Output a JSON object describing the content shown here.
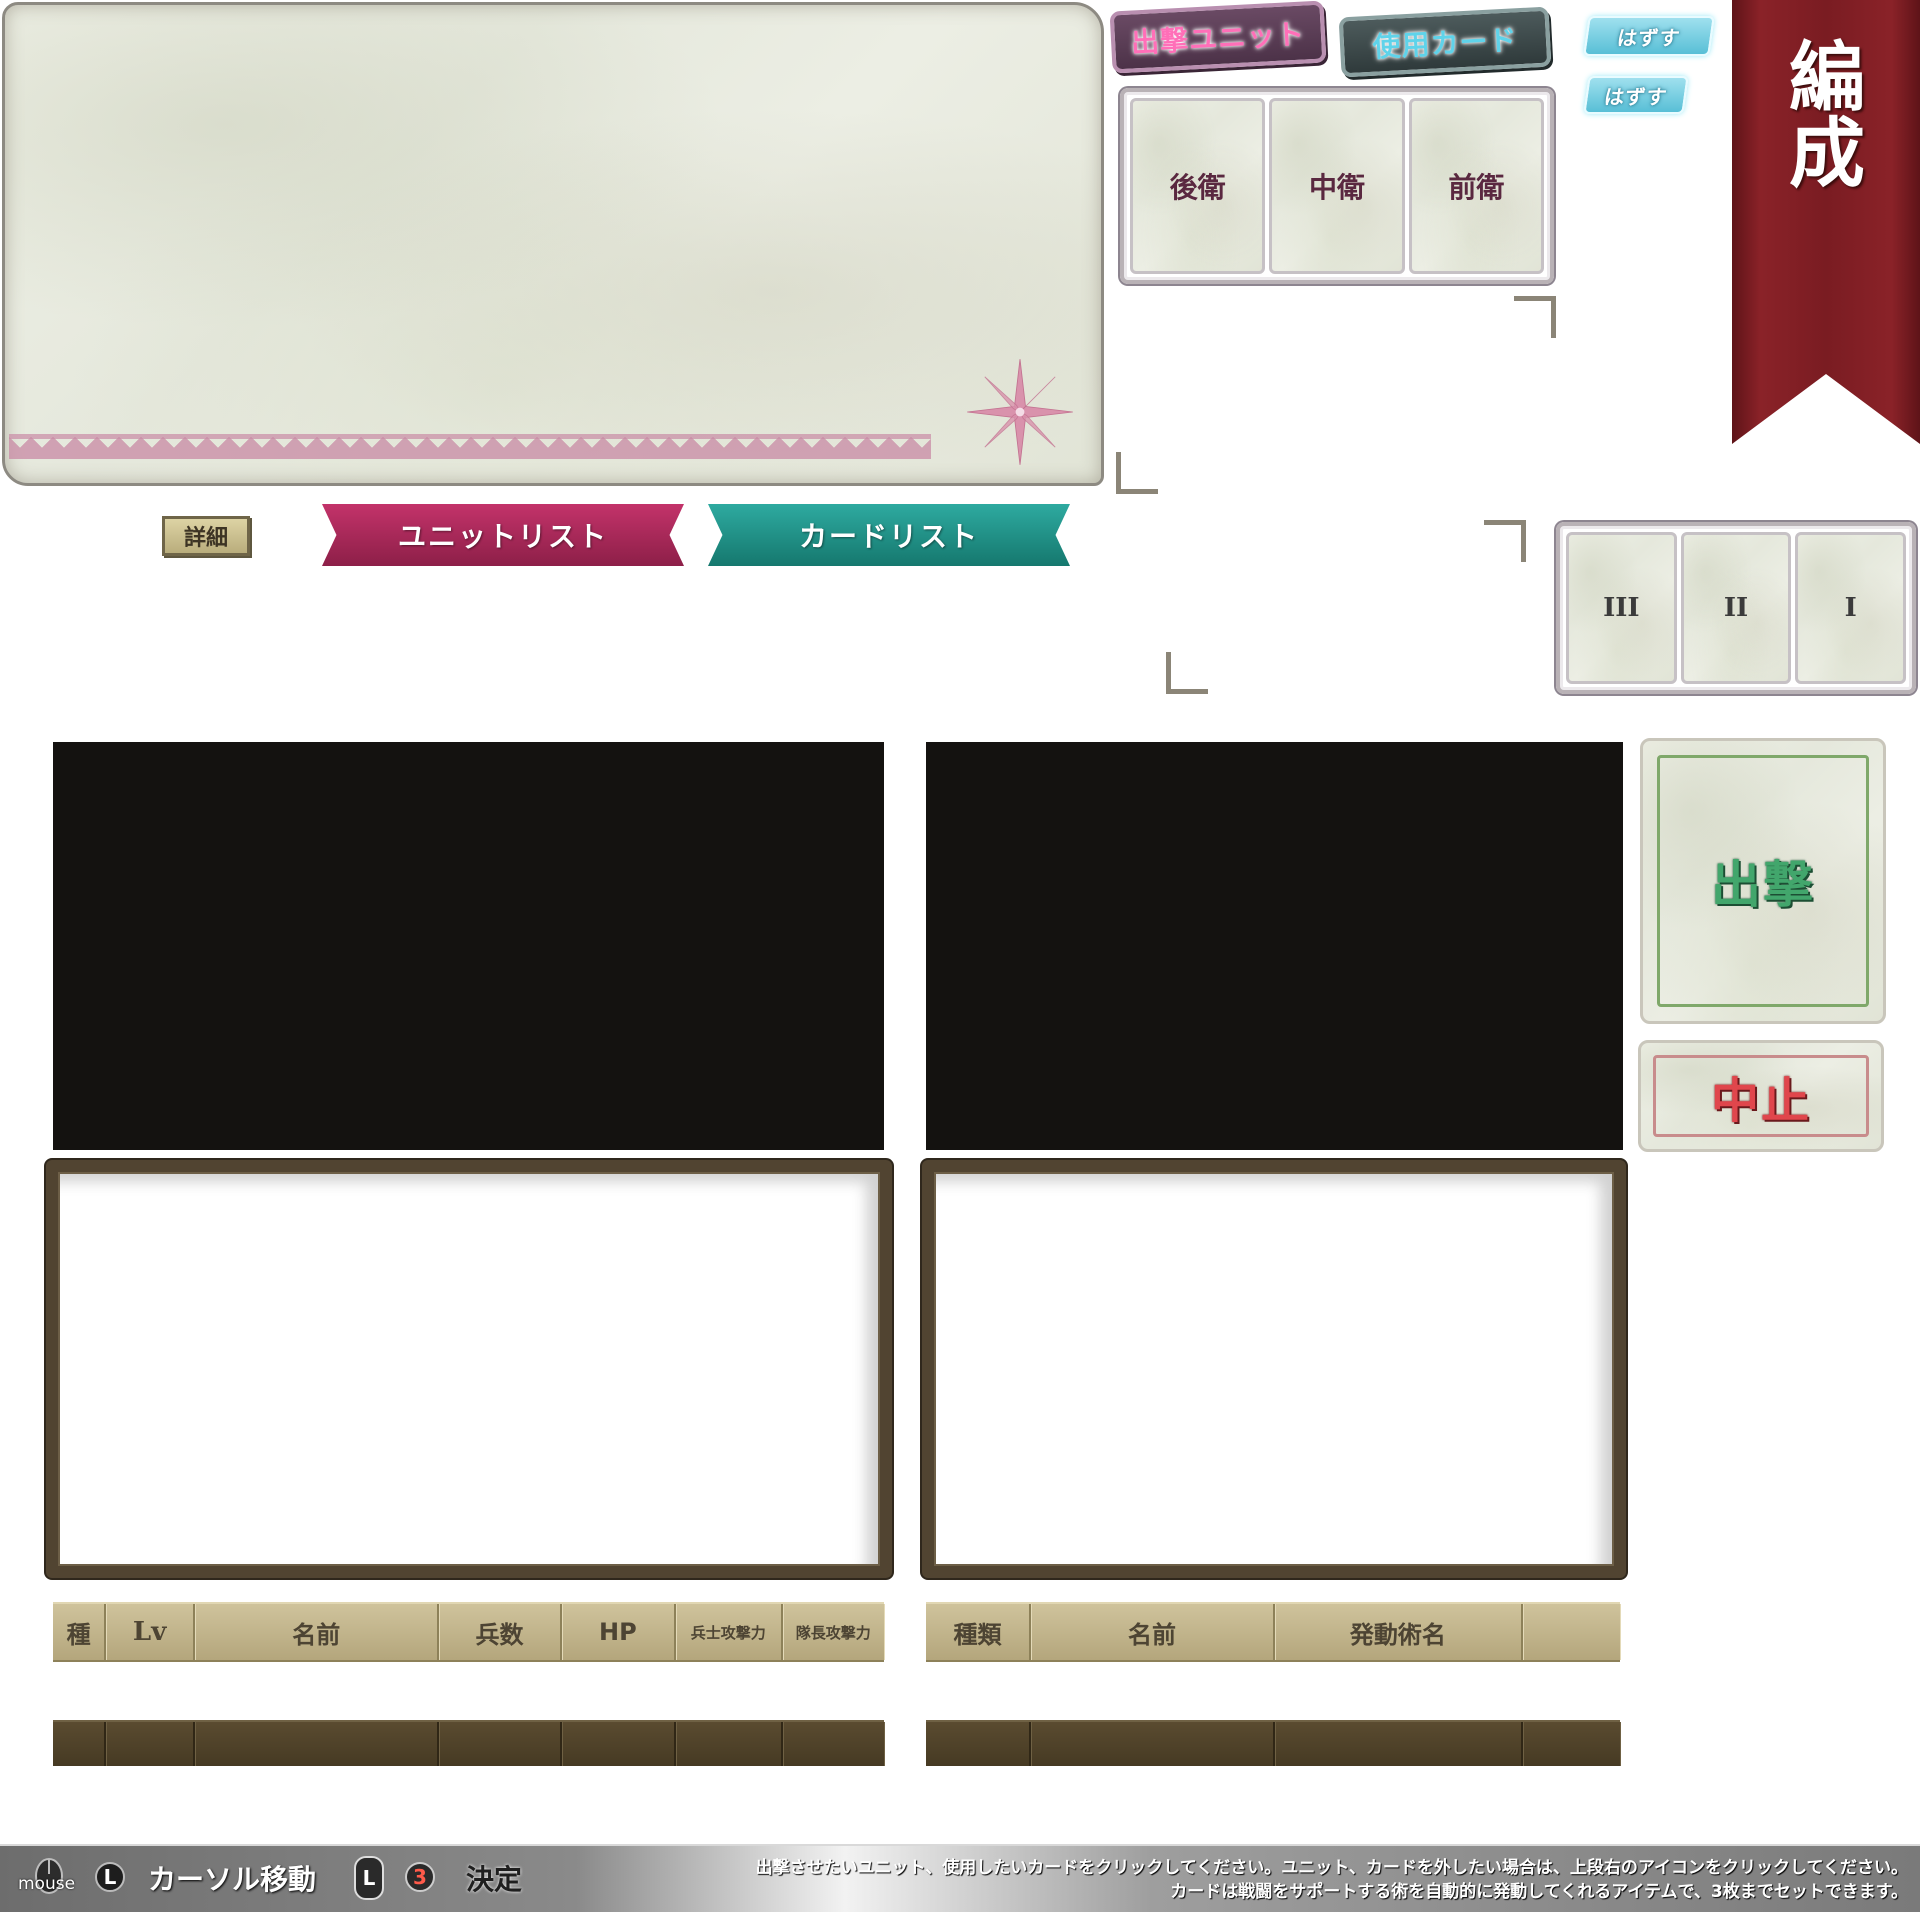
{
  "tags": {
    "sortie_unit": "出撃ユニット",
    "use_card": "使用カード",
    "remove_1": "はずす",
    "remove_2": "はずす"
  },
  "banner": {
    "title_line1": "編",
    "title_line2": "成",
    "color": "#7a1e22"
  },
  "positions": [
    "後衛",
    "中衛",
    "前衛"
  ],
  "card_slots": [
    "III",
    "II",
    "I"
  ],
  "detail_button": "詳細",
  "tabs": {
    "unit_list": "ユニットリスト",
    "card_list": "カードリスト"
  },
  "actions": {
    "sortie": "出撃",
    "cancel": "中止"
  },
  "unit_table": {
    "headers": [
      "種",
      "Lv",
      "名前",
      "兵数",
      "HP",
      "兵士攻撃力",
      "隊長攻撃力"
    ]
  },
  "card_table": {
    "headers": [
      "種類",
      "名前",
      "発動術名",
      ""
    ]
  },
  "bottom_bar": {
    "mouse_label": "mouse",
    "key_l": "L",
    "move_hint": "カーソル移動",
    "key_3": "3",
    "confirm_hint": "決定",
    "help_line_1": "出撃させたいユニット、使用したいカードをクリックしてください。ユニット、カードを外したい場合は、上段右のアイコンをクリックしてください。",
    "help_line_2": "カードは戦闘をサポートする術を自動的に発動してくれるアイテムで、3枚までセットできます。"
  },
  "colors": {
    "unit_ribbon": "#a8285a",
    "card_ribbon": "#1f8f85",
    "sortie_text": "#42a66c",
    "cancel_text": "#e0464c",
    "frame": "#514431"
  },
  "icons": [
    "compass-rose-icon",
    "mouse-icon",
    "l-button-icon",
    "l-stick-icon",
    "three-button-icon"
  ]
}
